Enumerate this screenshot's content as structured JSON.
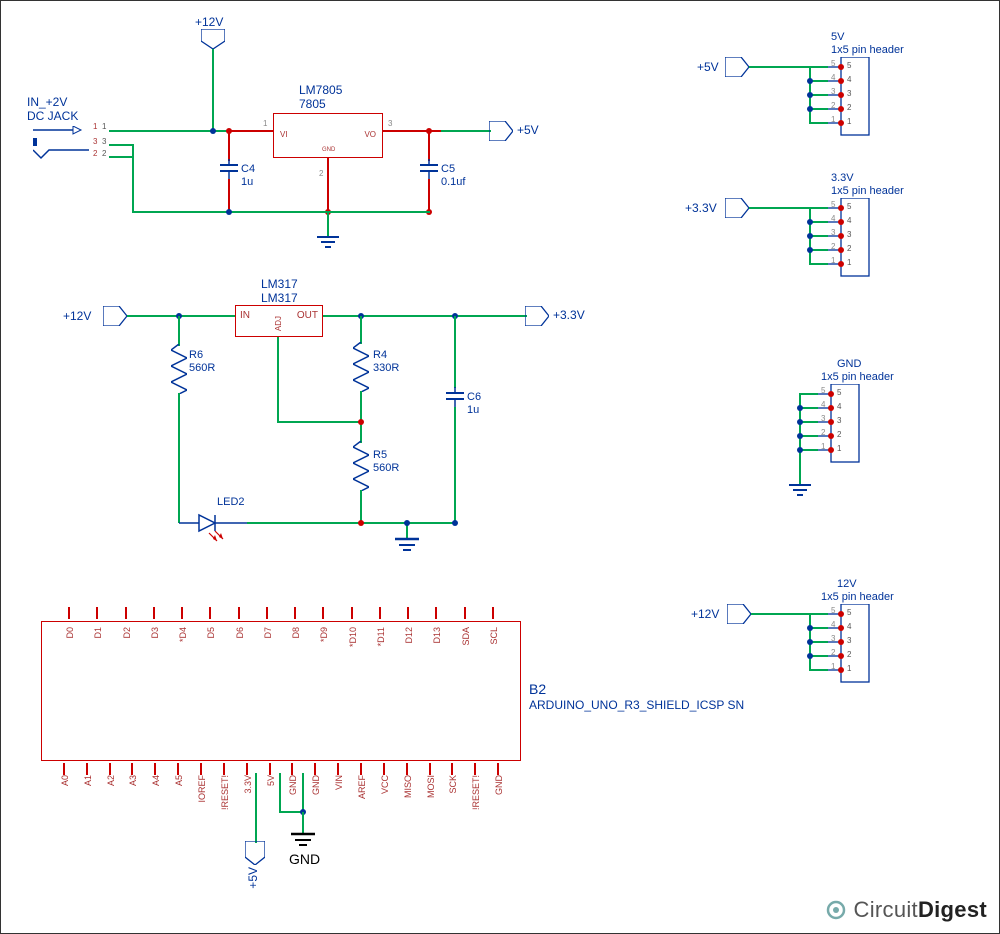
{
  "logo": {
    "a": "Circuit",
    "b": "Digest"
  },
  "net_labels": {
    "p12v": "+12V",
    "p5v": "+5V",
    "p3v3": "+3.3V",
    "in12v_dcjack": "IN_+2V\nDC JACK",
    "gnd": "GND"
  },
  "u1": {
    "name": "LM7805",
    "part": "7805",
    "p_vi": "VI",
    "p_vo": "VO",
    "p_gnd": "GND",
    "pin1": "1",
    "pin2": "2",
    "pin3": "3"
  },
  "u2": {
    "name": "LM317",
    "part": "LM317",
    "p_in": "IN",
    "p_out": "OUT",
    "p_adj": "ADJ"
  },
  "comp": {
    "c4": {
      "ref": "C4",
      "val": "1u"
    },
    "c5": {
      "ref": "C5",
      "val": "0.1uf"
    },
    "c6": {
      "ref": "C6",
      "val": "1u"
    },
    "r4": {
      "ref": "R4",
      "val": "330R"
    },
    "r5": {
      "ref": "R5",
      "val": "560R"
    },
    "r6": {
      "ref": "R6",
      "val": "560R"
    },
    "led2": {
      "ref": "LED2"
    }
  },
  "dc": {
    "p1": "1",
    "p2": "2",
    "p3": "3"
  },
  "headers": {
    "h5v": {
      "name": "5V",
      "desc": "1x5 pin header"
    },
    "h3v3": {
      "name": "3.3V",
      "desc": "1x5 pin header"
    },
    "h_gnd": {
      "name": "GND",
      "desc": "1x5 pin header"
    },
    "h12v": {
      "name": "12V",
      "desc": "1x5 pin header"
    }
  },
  "pins5": {
    "1": "1",
    "2": "2",
    "3": "3",
    "4": "4",
    "5": "5"
  },
  "b2": {
    "ref": "B2",
    "part": "ARDUINO_UNO_R3_SHIELD_ICSP SN",
    "top_row": [
      "D0",
      "D1",
      "D2",
      "D3",
      "*D4",
      "D5",
      "D6",
      "D7",
      "D8",
      "*D9",
      "*D10",
      "*D11",
      "D12",
      "D13",
      "SDA",
      "SCL"
    ],
    "bot_row": [
      "A0",
      "A1",
      "A2",
      "A3",
      "A4",
      "A5",
      "IOREF",
      "!RESET!",
      "3.3V",
      "5V",
      "GND",
      "GND",
      "VIN",
      "AREF",
      "VCC",
      "MISO",
      "MOSI",
      "SCK",
      "!RESET!",
      "GND"
    ]
  }
}
